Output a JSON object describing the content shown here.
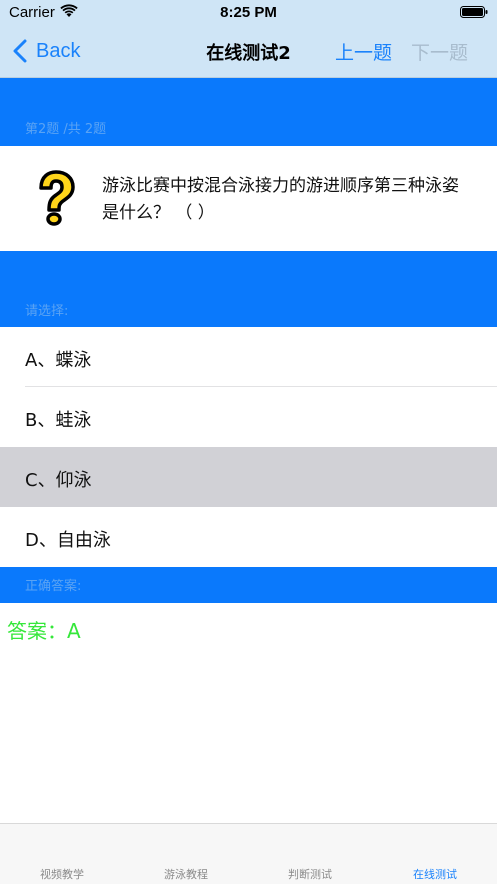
{
  "status_bar": {
    "carrier": "Carrier",
    "time": "8:25 PM"
  },
  "nav": {
    "back_label": "Back",
    "title": "在线测试2",
    "prev_label": "上一题",
    "next_label": "下一题"
  },
  "question_section": {
    "header": "第2题 /共 2题",
    "text": "游泳比赛中按混合泳接力的游进顺序第三种泳姿是什么？ （ ）",
    "icon": "question-mark-icon"
  },
  "options_section": {
    "header": "请选择:",
    "options": [
      {
        "label": "A、蝶泳",
        "selected": false
      },
      {
        "label": "B、蛙泳",
        "selected": false
      },
      {
        "label": "C、仰泳",
        "selected": true
      },
      {
        "label": "D、自由泳",
        "selected": false
      }
    ]
  },
  "answer_section": {
    "header": "正确答案:",
    "answer": "答案：A"
  },
  "tabs": [
    {
      "label": "视频教学",
      "active": false
    },
    {
      "label": "游泳教程",
      "active": false
    },
    {
      "label": "判断测试",
      "active": false
    },
    {
      "label": "在线测试",
      "active": true
    }
  ],
  "colors": {
    "accent": "#1a82fb",
    "section_blue": "#0a79fc",
    "answer_green": "#35e73a",
    "selected_row": "#d1d1d6"
  }
}
